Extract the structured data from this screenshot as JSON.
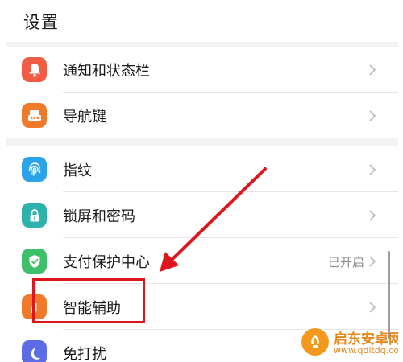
{
  "header": {
    "title": "设置"
  },
  "groups": [
    {
      "items": [
        {
          "label": "通知和状态栏",
          "icon": "bell-icon",
          "color": "#f25c45"
        },
        {
          "label": "导航键",
          "icon": "navigation-key-icon",
          "color": "#f07a2a"
        }
      ]
    },
    {
      "items": [
        {
          "label": "指纹",
          "icon": "fingerprint-icon",
          "color": "#2ba3e8"
        },
        {
          "label": "锁屏和密码",
          "icon": "lock-icon",
          "color": "#2eb2ad"
        },
        {
          "label": "支付保护中心",
          "icon": "shield-check-icon",
          "color": "#3ec06a",
          "value": "已开启"
        },
        {
          "label": "智能辅助",
          "icon": "hand-icon",
          "color": "#f07a2a"
        },
        {
          "label": "免打扰",
          "icon": "moon-icon",
          "color": "#5b6ce6"
        }
      ]
    }
  ],
  "annotation": {
    "arrow_color": "#e0141c",
    "box_color": "#e0141c"
  },
  "watermark": {
    "name": "启东安卓网",
    "url": "www.qdltdq.com"
  }
}
